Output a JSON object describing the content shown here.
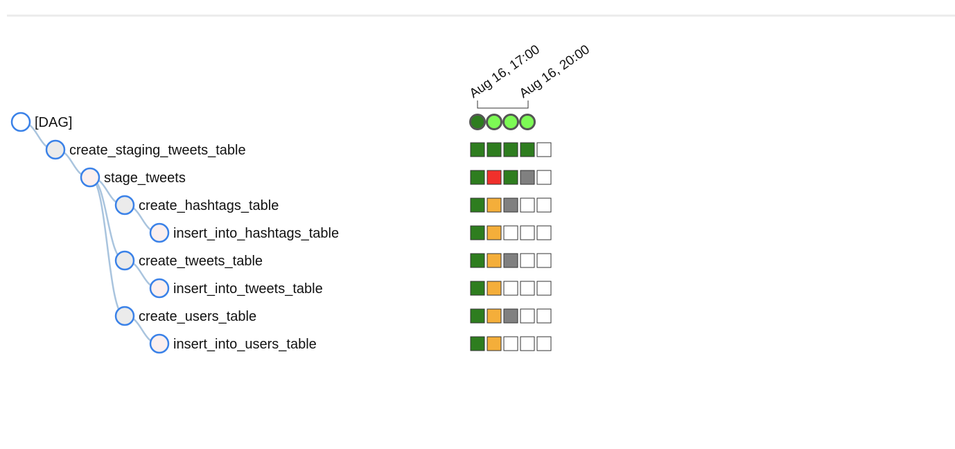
{
  "colors": {
    "success": "#2e7d1f",
    "failed": "#f0302b",
    "upstream_failed": "#f4ae3a",
    "skipped": "#808080",
    "running": "#7dfa55",
    "none": "#ffffff",
    "node_stroke": "#3b82e8",
    "node_fill_dag": "#ffffff",
    "node_fill_op": "#ebebeb",
    "node_fill_sql": "#fbefef",
    "link": "#a9c4de"
  },
  "dates": [
    "Aug 16, 17:00",
    "Aug 16, 20:00"
  ],
  "dag_runs": [
    "success",
    "running",
    "running",
    "running"
  ],
  "tasks": [
    {
      "label": "[DAG]",
      "depth": 0,
      "kind": "dag"
    },
    {
      "label": "create_staging_tweets_table",
      "depth": 1,
      "kind": "op",
      "parent": 0,
      "states": [
        "success",
        "success",
        "success",
        "success",
        "none"
      ]
    },
    {
      "label": "stage_tweets",
      "depth": 2,
      "kind": "sql",
      "parent": 1,
      "states": [
        "success",
        "failed",
        "success",
        "skipped",
        "none"
      ]
    },
    {
      "label": "create_hashtags_table",
      "depth": 3,
      "kind": "op",
      "parent": 2,
      "states": [
        "success",
        "upstream_failed",
        "skipped",
        "none",
        "none"
      ]
    },
    {
      "label": "insert_into_hashtags_table",
      "depth": 4,
      "kind": "sql",
      "parent": 3,
      "states": [
        "success",
        "upstream_failed",
        "none",
        "none",
        "none"
      ]
    },
    {
      "label": "create_tweets_table",
      "depth": 3,
      "kind": "op",
      "parent": 2,
      "states": [
        "success",
        "upstream_failed",
        "skipped",
        "none",
        "none"
      ]
    },
    {
      "label": "insert_into_tweets_table",
      "depth": 4,
      "kind": "sql",
      "parent": 5,
      "states": [
        "success",
        "upstream_failed",
        "none",
        "none",
        "none"
      ]
    },
    {
      "label": "create_users_table",
      "depth": 3,
      "kind": "op",
      "parent": 2,
      "states": [
        "success",
        "upstream_failed",
        "skipped",
        "none",
        "none"
      ]
    },
    {
      "label": "insert_into_users_table",
      "depth": 4,
      "kind": "sql",
      "parent": 7,
      "states": [
        "success",
        "upstream_failed",
        "none",
        "none",
        "none"
      ]
    }
  ]
}
